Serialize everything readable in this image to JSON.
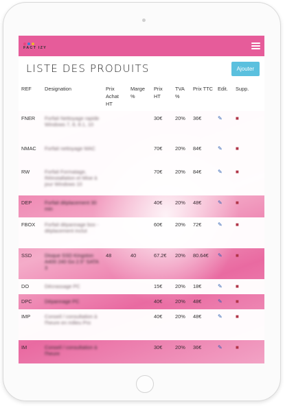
{
  "app": {
    "logo_text": "FACT IZY",
    "logo_colors": [
      "#e8457d",
      "#3d7fd6",
      "#f0b52a"
    ]
  },
  "page": {
    "title": "LISTE DES PRODUITS",
    "add_button": "Ajouter"
  },
  "table": {
    "headers": {
      "ref": "REF",
      "designation": "Designation",
      "prix_achat": "Prix Achat HT",
      "marge": "Marge %",
      "prix_ht": "Prix HT",
      "tva": "TVA %",
      "prix_ttc": "Prix TTC",
      "edit": "Edit.",
      "supp": "Supp."
    },
    "rows": [
      {
        "ref": "FNER",
        "designation": "Forfait Nettoyage rapide Windows 7, 8, 8.1, 10",
        "prix_achat": "",
        "marge": "",
        "prix_ht": "30€",
        "tva": "20%",
        "prix_ttc": "36€"
      },
      {
        "ref": "NMAC",
        "designation": "Forfait nettoyage MAC",
        "prix_achat": "",
        "marge": "",
        "prix_ht": "70€",
        "tva": "20%",
        "prix_ttc": "84€"
      },
      {
        "ref": "RW",
        "designation": "Forfait Formatage, Réinstallation et Mise à jour Windows 10",
        "prix_achat": "",
        "marge": "",
        "prix_ht": "70€",
        "tva": "20%",
        "prix_ttc": "84€"
      },
      {
        "ref": "DEP",
        "designation": "Forfait déplacement 30 min",
        "prix_achat": "",
        "marge": "",
        "prix_ht": "40€",
        "tva": "20%",
        "prix_ttc": "48€"
      },
      {
        "ref": "FBOX",
        "designation": "Forfait dépannage box - déplacement inclut",
        "prix_achat": "",
        "marge": "",
        "prix_ht": "60€",
        "tva": "20%",
        "prix_ttc": "72€"
      },
      {
        "ref": "SSD",
        "designation": "Disque SSD Kingston A400 240 Go 2.5\" SATA 3",
        "prix_achat": "48",
        "marge": "40",
        "prix_ht": "67.2€",
        "tva": "20%",
        "prix_ttc": "80.64€"
      },
      {
        "ref": "DO",
        "designation": "Décrassage PC",
        "prix_achat": "",
        "marge": "",
        "prix_ht": "15€",
        "tva": "20%",
        "prix_ttc": "18€"
      },
      {
        "ref": "DPC",
        "designation": "Dépannage PC",
        "prix_achat": "",
        "marge": "",
        "prix_ht": "40€",
        "tva": "20%",
        "prix_ttc": "48€"
      },
      {
        "ref": "IMP",
        "designation": "Conseil / consultation à l'heure en milieu Pro",
        "prix_achat": "",
        "marge": "",
        "prix_ht": "40€",
        "tva": "20%",
        "prix_ttc": "48€"
      },
      {
        "ref": "IM",
        "designation": "Conseil / consultation à l'heure",
        "prix_achat": "",
        "marge": "",
        "prix_ht": "30€",
        "tva": "20%",
        "prix_ttc": "36€"
      }
    ],
    "edit_icon": "edit-icon",
    "delete_icon": "trash-icon"
  },
  "colors": {
    "navbar": "#e65c9a",
    "add_button": "#5bc0de",
    "edit_icon": "#2a5db0",
    "delete_icon": "#b03548"
  }
}
